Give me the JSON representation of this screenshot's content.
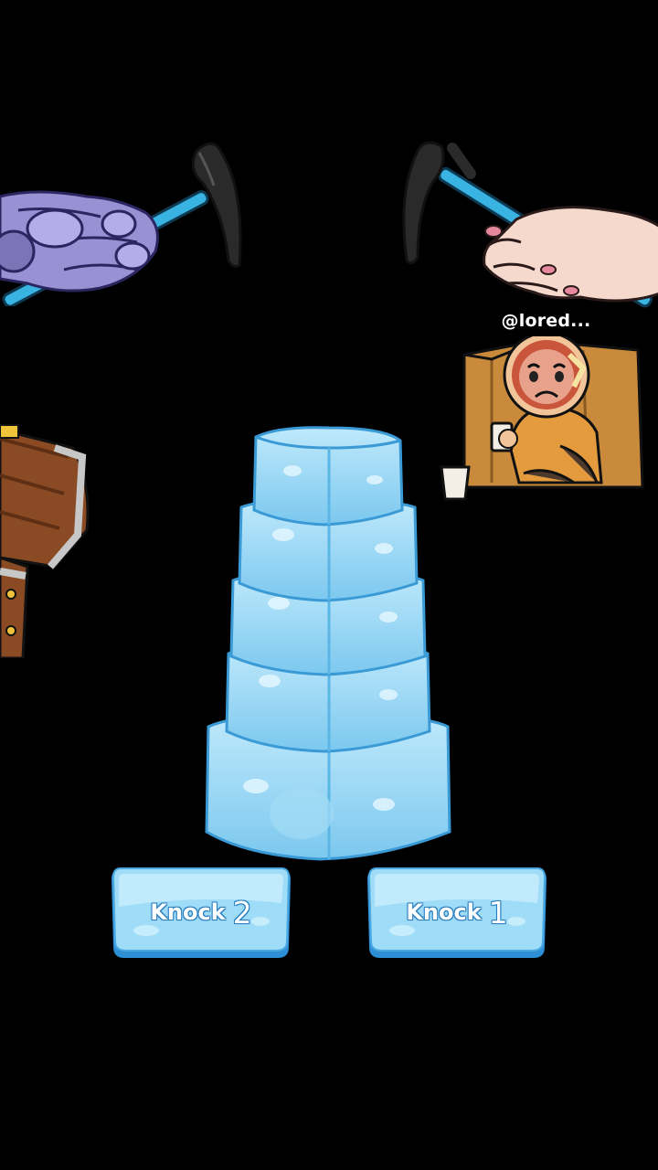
{
  "overlay": {
    "username": "@lored..."
  },
  "buttons": [
    {
      "word": "Knock",
      "number": "2"
    },
    {
      "word": "Knock",
      "number": "1"
    }
  ],
  "colors": {
    "background": "#000000",
    "ice_light": "#bfe9fb",
    "ice_mid": "#8fd3f4",
    "ice_dark": "#4fb2e6",
    "button_edge": "#2f8fd6",
    "hammer_handle": "#39b4e2",
    "hammer_head": "#2a2a2a"
  },
  "icons": [
    "robot-hand-hammer-icon",
    "human-hand-hammer-icon",
    "treasure-chest-icon",
    "sad-person-in-box-icon",
    "ice-block-tower-icon"
  ]
}
